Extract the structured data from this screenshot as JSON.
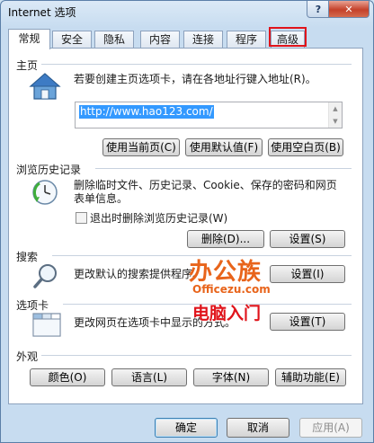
{
  "window": {
    "title": "Internet 选项",
    "help": "?",
    "close": "✕"
  },
  "tabs": [
    "常规",
    "安全",
    "隐私",
    "内容",
    "连接",
    "程序",
    "高级"
  ],
  "home": {
    "header": "主页",
    "instruction": "若要创建主页选项卡，请在各地址行键入地址(R)。",
    "url": "http://www.hao123.com/",
    "buttons": [
      "使用当前页(C)",
      "使用默认值(F)",
      "使用空白页(B)"
    ]
  },
  "history": {
    "header": "浏览历史记录",
    "line1": "删除临时文件、历史记录、Cookie、保存的密码和网页",
    "line2": "表单信息。",
    "checkbox_label": "退出时删除浏览历史记录(W)",
    "checkbox_checked": false,
    "delete_button": "删除(D)...",
    "settings_button": "设置(S)"
  },
  "search": {
    "header": "搜索",
    "text": "更改默认的搜索提供程序。",
    "settings_button": "设置(I)"
  },
  "tabs_section": {
    "header": "选项卡",
    "text": "更改网页在选项卡中显示的方式。",
    "settings_button": "设置(T)"
  },
  "appearance": {
    "header": "外观",
    "buttons": [
      "颜色(O)",
      "语言(L)",
      "字体(N)",
      "辅助功能(E)"
    ]
  },
  "footer": {
    "ok": "确定",
    "cancel": "取消",
    "apply": "应用(A)"
  },
  "watermark": {
    "brand": "办公族",
    "site": "Officezu.com",
    "tagline": "电脑入门"
  },
  "colors": {
    "highlight_box": "#e0141b",
    "url_selection": "#3399ff",
    "watermark": "#e8641b"
  }
}
